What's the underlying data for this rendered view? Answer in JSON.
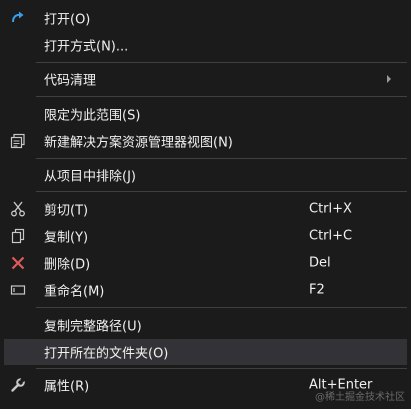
{
  "menu": {
    "items": [
      {
        "label": "打开(O)",
        "icon": "redo-arrow-icon"
      },
      {
        "label": "打开方式(N)..."
      },
      {
        "label": "代码清理",
        "submenu": true
      },
      {
        "label": "限定为此范围(S)"
      },
      {
        "label": "新建解决方案资源管理器视图(N)",
        "icon": "new-view-icon"
      },
      {
        "label": "从项目中排除(J)"
      },
      {
        "label": "剪切(T)",
        "shortcut": "Ctrl+X",
        "icon": "scissors-icon"
      },
      {
        "label": "复制(Y)",
        "shortcut": "Ctrl+C",
        "icon": "copy-icon"
      },
      {
        "label": "删除(D)",
        "shortcut": "Del",
        "icon": "delete-x-icon"
      },
      {
        "label": "重命名(M)",
        "shortcut": "F2",
        "icon": "rename-icon"
      },
      {
        "label": "复制完整路径(U)"
      },
      {
        "label": "打开所在的文件夹(O)"
      },
      {
        "label": "属性(R)",
        "shortcut": "Alt+Enter",
        "icon": "wrench-icon"
      }
    ]
  },
  "watermark": "@稀土掘金技术社区",
  "colors": {
    "background": "#1b1b1c",
    "hover": "#333337",
    "separator": "#3f3f46",
    "text": "#f1f1f1",
    "icon_blue": "#3c9ee8",
    "delete_red": "#e05a5a"
  }
}
